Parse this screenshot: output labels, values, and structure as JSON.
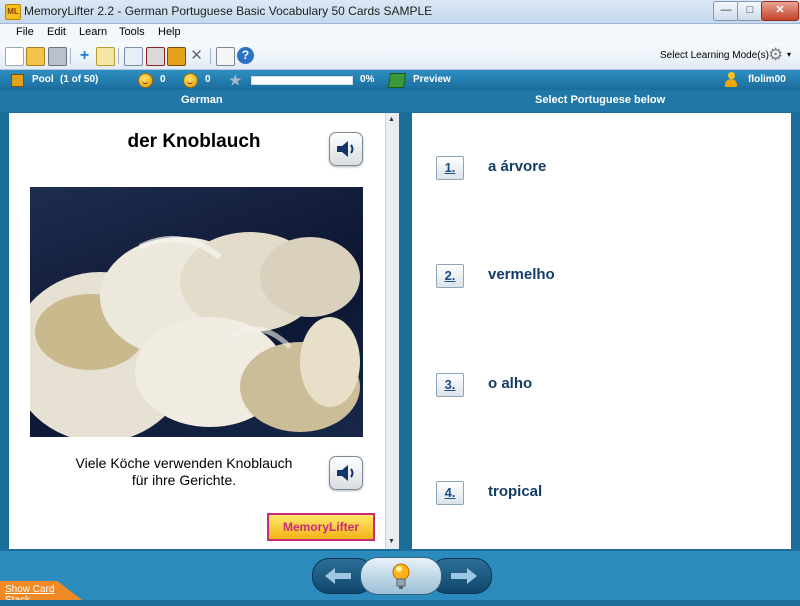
{
  "window": {
    "title": "MemoryLifter 2.2 - German Portuguese Basic Vocabulary 50 Cards SAMPLE",
    "app_icon_text": "ML",
    "min_glyph": "—",
    "max_glyph": "□",
    "close_glyph": "✕"
  },
  "menu": {
    "items": [
      "File",
      "Edit",
      "Learn",
      "Tools",
      "Help"
    ]
  },
  "toolbar": {
    "mode_label": "Select Learning Mode(s)",
    "mode_arrow": "▾"
  },
  "status": {
    "pool_label": "Pool",
    "pool_count": "(1 of 50)",
    "correct_count": "0",
    "wrong_count": "0",
    "progress_percent": 0,
    "progress_text": "0%",
    "preview_label": "Preview",
    "user_name": "flolim00"
  },
  "columns": {
    "question_header": "German",
    "answer_header": "Select Portuguese below"
  },
  "card": {
    "word": "der Knoblauch",
    "sentence_line1": "Viele Köche verwenden Knoblauch",
    "sentence_line2": "für ihre Gerichte.",
    "logo_text": "MemoryLifter"
  },
  "choices": [
    {
      "number": "1.",
      "text": "a árvore"
    },
    {
      "number": "2.",
      "text": "vermelho"
    },
    {
      "number": "3.",
      "text": "o alho"
    },
    {
      "number": "4.",
      "text": "tropical"
    }
  ],
  "bottom": {
    "show_stack_label": "Show Card Stack"
  },
  "colors": {
    "frame_blue": "#1b6d9a",
    "choice_text": "#143c66",
    "accent_orange": "#f08a24"
  }
}
